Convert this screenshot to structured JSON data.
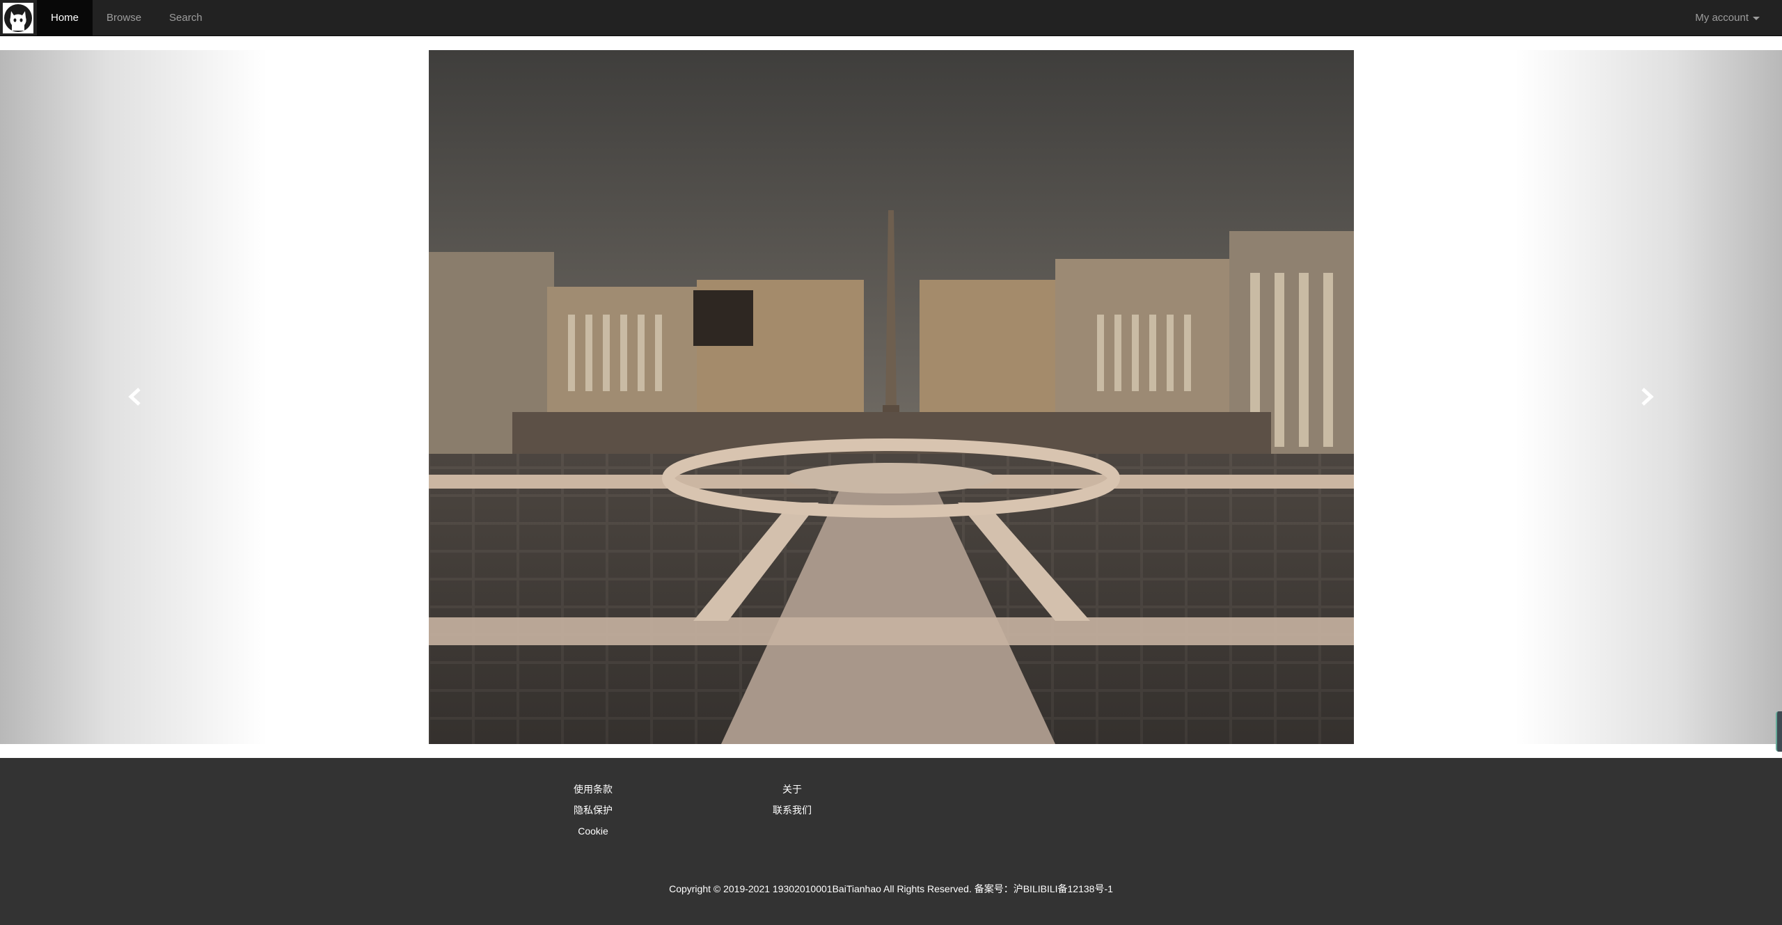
{
  "nav": {
    "brand_icon": "github-octocat-icon",
    "items": [
      {
        "label": "Home",
        "active": true
      },
      {
        "label": "Browse",
        "active": false
      },
      {
        "label": "Search",
        "active": false
      }
    ],
    "account_label": "My account"
  },
  "carousel": {
    "prev_icon": "chevron-left-icon",
    "next_icon": "chevron-right-icon",
    "slide_count": 3,
    "active_slide": 1
  },
  "footer": {
    "col1": [
      "使用条款",
      "隐私保护",
      "Cookie"
    ],
    "col2": [
      "关于",
      "联系我们"
    ],
    "copyright": "Copyright © 2019-2021 19302010001BaiTianhao All Rights Reserved. 备案号：沪BILIBILI备12138号-1"
  },
  "colors": {
    "navbar_bg": "#222222",
    "footer_bg": "#333333",
    "nav_text": "#9d9d9d"
  }
}
